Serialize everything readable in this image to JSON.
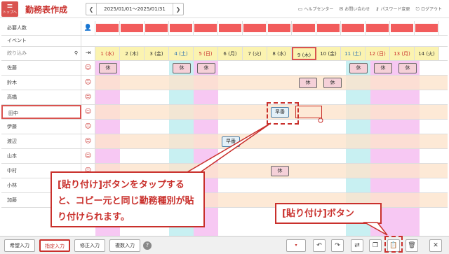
{
  "header": {
    "menu_label": "トップへ",
    "title": "勤務表作成",
    "date_range": "2025/01/01～2025/01/31",
    "links": [
      "ヘルプセンター",
      "お問い合わせ",
      "パスワード変更",
      "ログアウト"
    ]
  },
  "grid": {
    "required_label": "必要人数",
    "event_label": "イベント",
    "filter_placeholder": "絞り込み",
    "days": [
      "1 (水)",
      "2 (木)",
      "3 (金)",
      "4 (土)",
      "5 (日)",
      "6 (月)",
      "7 (火)",
      "8 (水)",
      "9 (木)",
      "10 (金)",
      "11 (土)",
      "12 (日)",
      "13 (月)",
      "14 (火)"
    ],
    "staff": [
      "佐藤",
      "鈴木",
      "高橋",
      "田中",
      "伊藤",
      "渡辺",
      "山本",
      "中村",
      "小林",
      "加藤"
    ],
    "shift_off": "休",
    "shift_early": "早番"
  },
  "callouts": {
    "paste_explain": "[貼り付け]ボタンをタップすると、コピー元と同じ勤務種別が貼り付けられます。",
    "paste_button": "[貼り付け]ボタン"
  },
  "bottom": {
    "buttons": [
      "希望入力",
      "指定入力",
      "修正入力",
      "複数入力"
    ]
  }
}
